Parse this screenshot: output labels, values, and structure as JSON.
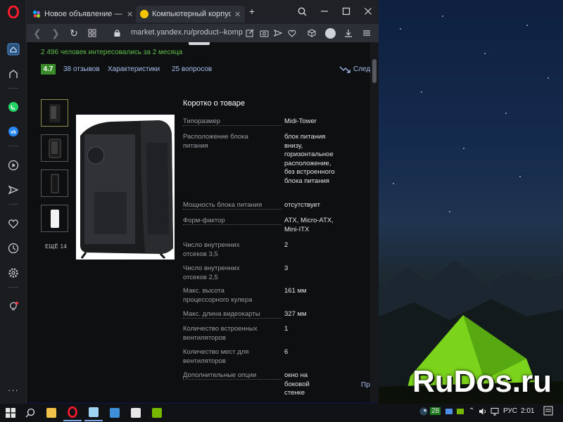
{
  "browser": {
    "tabs": [
      {
        "title": "Новое объявление — Объ",
        "favicon_color": "#4f8de8",
        "active": false
      },
      {
        "title": "Компьютерный корпус Ae",
        "favicon_color": "#f5c400",
        "active": true
      }
    ],
    "new_tab": "+",
    "url": "market.yandex.ru/product--komp"
  },
  "product": {
    "interest_text": "2 496 человек интересовались за 2 месяца",
    "rating": "4.7",
    "links": [
      "38 отзывов",
      "Характеристики",
      "25 вопросов"
    ],
    "follow_label": "След",
    "more_photos": "ЕЩЁ 14"
  },
  "specs": {
    "title": "Коротко о товаре",
    "rows": [
      {
        "name": "Типоразмер",
        "value": "Midi-Tower"
      },
      {
        "name": "Расположение блока питания",
        "value": "блок питания внизу, горизонтальное расположение, без встроенного блока питания"
      },
      {
        "name": "Мощность блока питания",
        "value": "отсутствует"
      },
      {
        "name": "Форм-фактор",
        "value": "ATX, Micro-ATX, Mini-ITX"
      },
      {
        "name": "Число внутренних отсеков 3,5",
        "value": "2"
      },
      {
        "name": "Число внутренних отсеков 2,5",
        "value": "3"
      },
      {
        "name": "Макс. высота процессорного кулера",
        "value": "161 мм"
      },
      {
        "name": "Макс. длина видеокарты",
        "value": "327 мм"
      },
      {
        "name": "Количество встроенных вентиляторов",
        "value": "1"
      },
      {
        "name": "Количество мест для вентиляторов",
        "value": "6"
      },
      {
        "name": "Дополнительные опции",
        "value": "окно на боковой стенке"
      }
    ],
    "next_label": "Пр"
  },
  "desktop": {
    "watermark": "RuDos.ru"
  },
  "taskbar": {
    "tray_count": "28",
    "language": "РУС",
    "time": "2:01"
  }
}
